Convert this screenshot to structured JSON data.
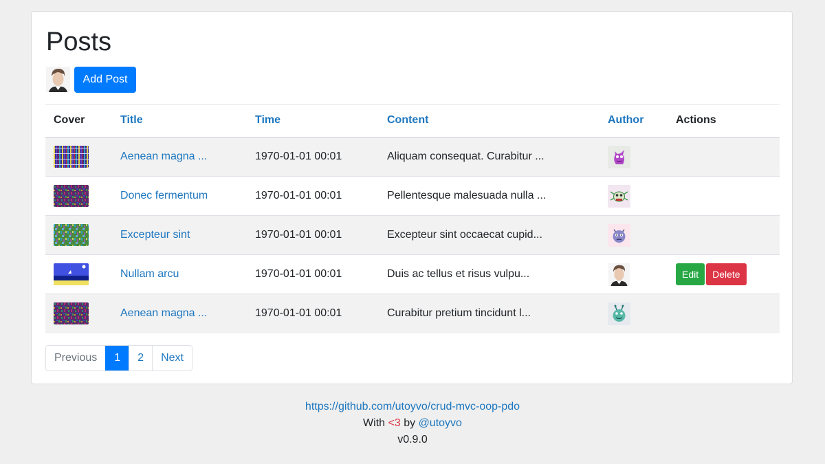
{
  "page": {
    "title": "Posts"
  },
  "toolbar": {
    "add_post_label": "Add Post"
  },
  "table": {
    "headers": {
      "cover": "Cover",
      "title": "Title",
      "time": "Time",
      "content": "Content",
      "author": "Author",
      "actions": "Actions"
    },
    "rows": [
      {
        "title": "Aenean magna ...",
        "time": "1970-01-01 00:01",
        "content": "Aliquam consequat. Curabitur ...",
        "cover": "noise-blue-cover",
        "author": "purple-monster-avatar"
      },
      {
        "title": "Donec fermentum",
        "time": "1970-01-01 00:01",
        "content": "Pellentesque malesuada nulla ...",
        "cover": "noise-purple-cover",
        "author": "green-monster-avatar"
      },
      {
        "title": "Excepteur sint",
        "time": "1970-01-01 00:01",
        "content": "Excepteur sint occaecat cupid...",
        "cover": "noise-green-cover",
        "author": "blue-monster-avatar"
      },
      {
        "title": "Nullam arcu",
        "time": "1970-01-01 00:01",
        "content": "Duis ac tellus et risus vulpu...",
        "cover": "night-beach-cover",
        "author": "man-portrait-avatar",
        "edit_label": "Edit",
        "delete_label": "Delete"
      },
      {
        "title": "Aenean magna ...",
        "time": "1970-01-01 00:01",
        "content": "Curabitur pretium tincidunt l...",
        "cover": "noise-purple-cover",
        "author": "teal-monster-avatar"
      }
    ]
  },
  "pagination": {
    "previous": "Previous",
    "page1": "1",
    "page2": "2",
    "next": "Next",
    "current": 1
  },
  "footer": {
    "repo_link": "https://github.com/utoyvo/crud-mvc-oop-pdo",
    "with_text": "With",
    "heart_text": "<3",
    "by_text": "by",
    "author_link": "@utoyvo",
    "version": "v0.9.0"
  },
  "colors": {
    "primary": "#007bff",
    "link": "#1c76bf",
    "success": "#28a745",
    "danger": "#dc3545",
    "page_bg": "#efefef",
    "stripe": "#f2f2f2"
  }
}
